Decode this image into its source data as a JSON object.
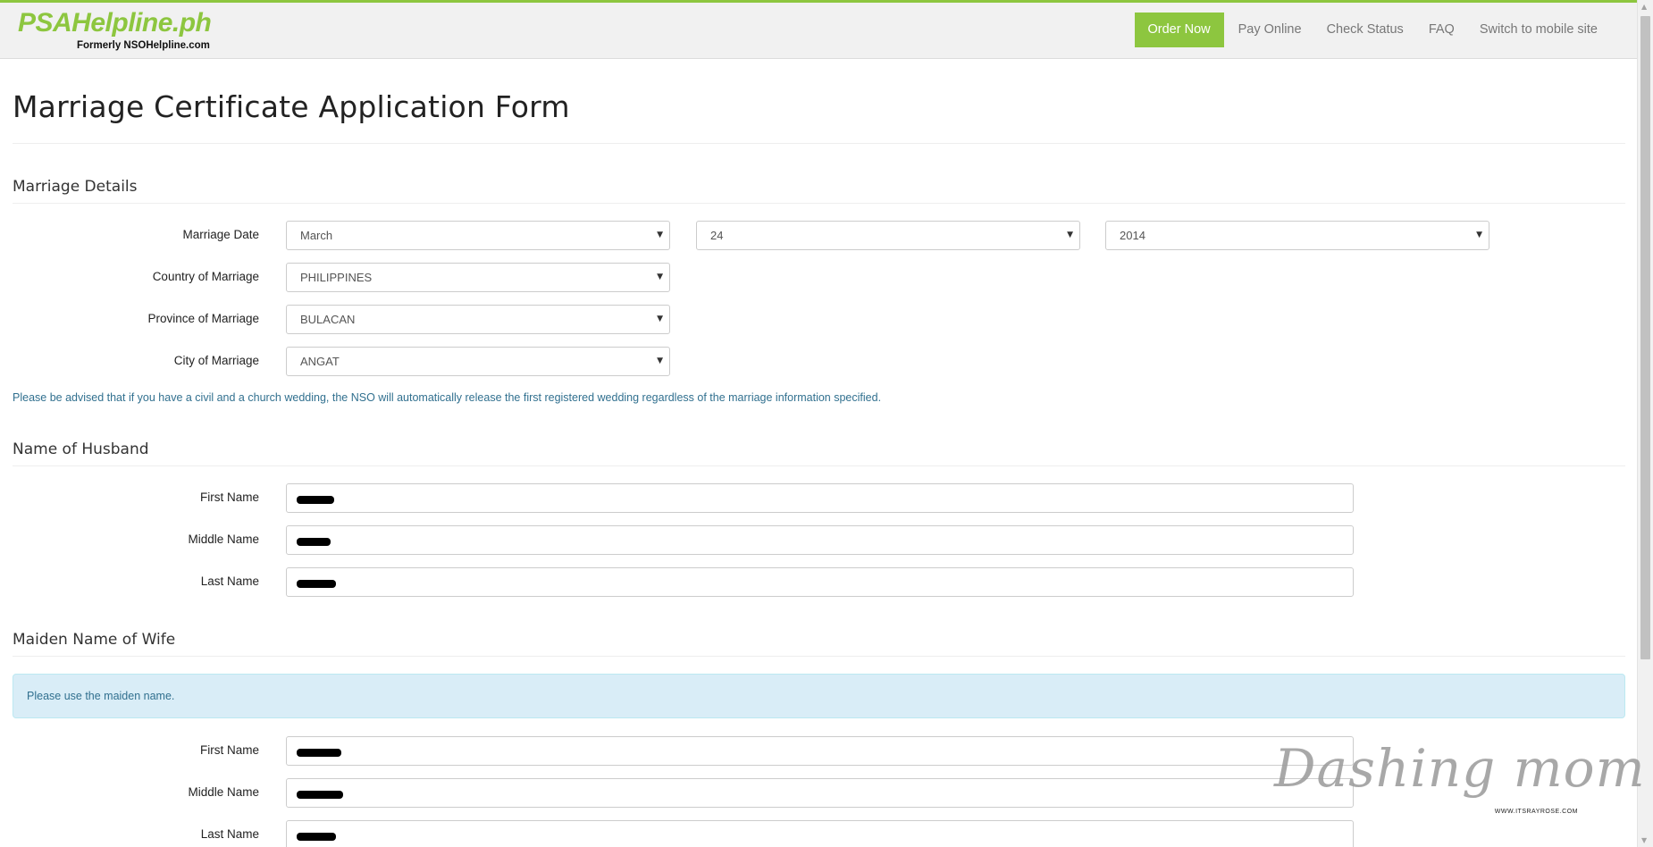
{
  "header": {
    "logo_main": "PSAHelpline.ph",
    "logo_sub": "Formerly NSOHelpline.com",
    "nav": [
      {
        "label": "Order Now"
      },
      {
        "label": "Pay Online"
      },
      {
        "label": "Check Status"
      },
      {
        "label": "FAQ"
      },
      {
        "label": "Switch to mobile site"
      }
    ],
    "accent_color": "#8dc63f"
  },
  "page": {
    "title": "Marriage Certificate Application Form"
  },
  "marriage_details": {
    "title": "Marriage Details",
    "date_label": "Marriage Date",
    "month": "March",
    "day": "24",
    "year": "2014",
    "country_label": "Country of Marriage",
    "country": "PHILIPPINES",
    "province_label": "Province of Marriage",
    "province": "BULACAN",
    "city_label": "City of Marriage",
    "city": "ANGAT",
    "note": "Please be advised that if you have a civil and a church wedding, the NSO will automatically release the first registered wedding regardless of the marriage information specified."
  },
  "husband": {
    "title": "Name of Husband",
    "first_label": "First Name",
    "middle_label": "Middle Name",
    "last_label": "Last Name"
  },
  "wife": {
    "title": "Maiden Name of Wife",
    "info": "Please use the maiden name.",
    "first_label": "First Name",
    "middle_label": "Middle Name",
    "last_label": "Last Name"
  },
  "watermark": {
    "main": "Dashing mom",
    "sub": "WWW.ITSRAYROSE.COM"
  },
  "icons": {
    "dropdown": "triangle-down",
    "scroll_up": "triangle-up",
    "scroll_down": "triangle-down"
  }
}
